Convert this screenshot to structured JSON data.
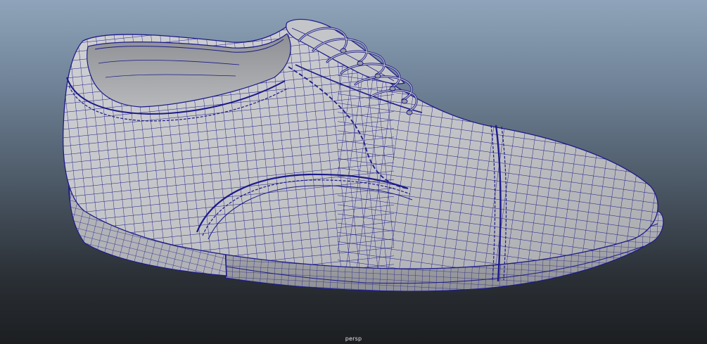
{
  "viewport": {
    "camera_name": "persp",
    "background_top": "#8fa4ba",
    "background_bottom": "#1c1e21",
    "wire_color": "#1c1a8a",
    "surface_color": "#c9cacd"
  },
  "scene": {
    "object": "shoe-mesh",
    "display": "wireframe-on-shaded"
  }
}
